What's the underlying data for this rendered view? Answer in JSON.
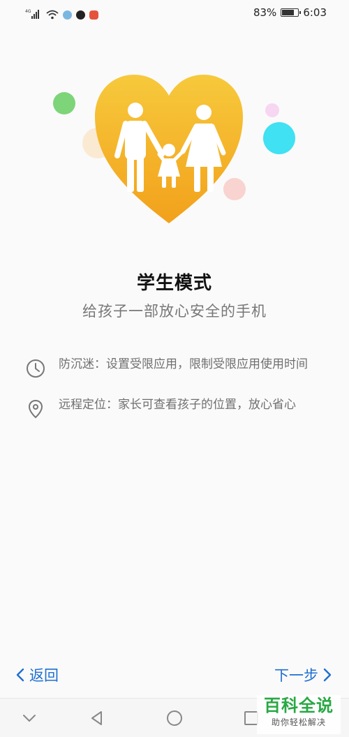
{
  "status_bar": {
    "network": "4G",
    "battery_percent": "83%",
    "battery_level": 0.83,
    "time": "6:03",
    "icons": [
      "signal-icon",
      "wifi-icon",
      "app-icon-1",
      "tiktok-icon",
      "app-icon-2"
    ]
  },
  "hero": {
    "icon": "family-heart-illustration",
    "colors": {
      "heart_top": "#f7c63a",
      "heart_bottom": "#f3a21c"
    }
  },
  "title": "学生模式",
  "subtitle": "给孩子一部放心安全的手机",
  "features": [
    {
      "icon": "clock-icon",
      "text": "防沉迷：设置受限应用，限制受限应用使用时间"
    },
    {
      "icon": "location-pin-icon",
      "text": "远程定位：家长可查看孩子的位置，放心省心"
    }
  ],
  "footer": {
    "back_label": "返回",
    "next_label": "下一步"
  },
  "watermark": {
    "title": "百科全说",
    "subtitle": "助你轻松解决"
  },
  "colors": {
    "accent": "#1f6fd1",
    "background": "#fafafa"
  }
}
